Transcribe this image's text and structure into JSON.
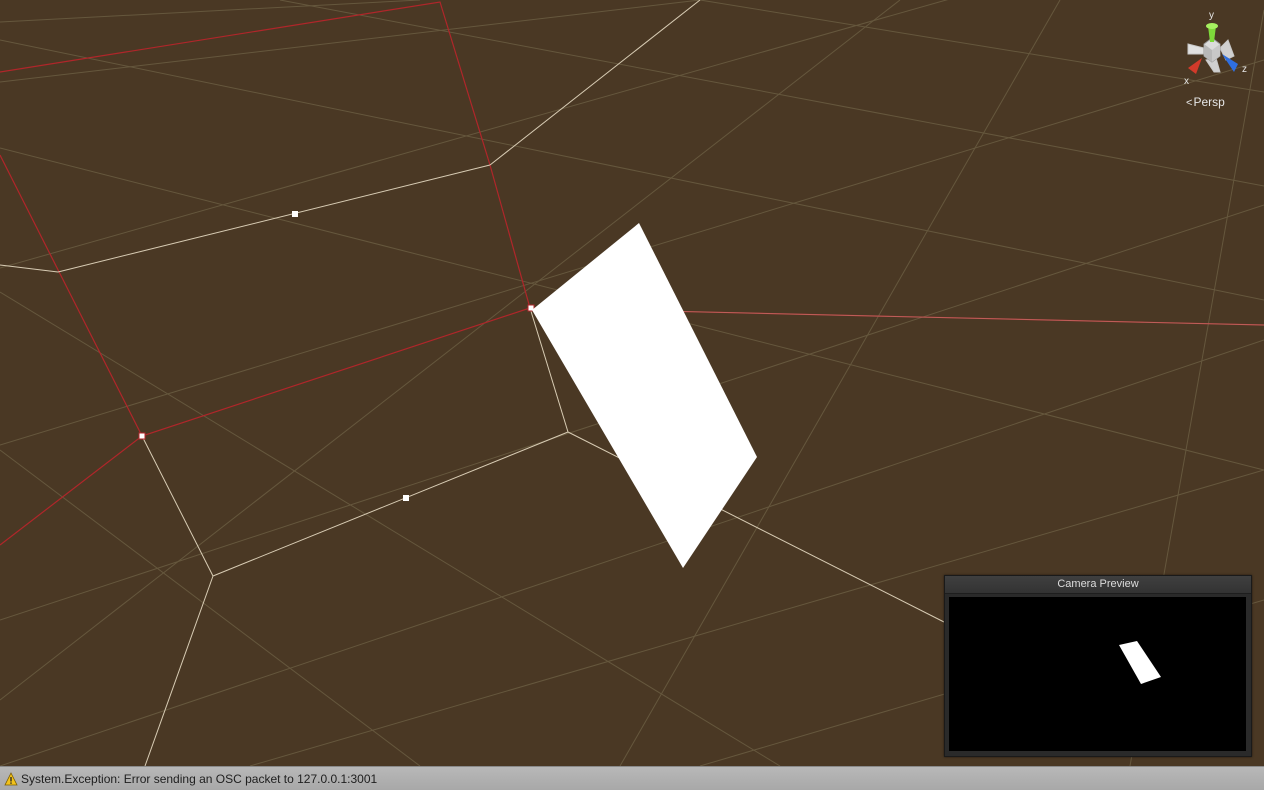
{
  "scene": {
    "background_color": "#4a3824",
    "grid_color": "#6f6246",
    "selection_color": "#b0262a",
    "wire_color": "#d8ccb4"
  },
  "gizmo": {
    "axis_y": "y",
    "axis_x": "x",
    "axis_z": "z",
    "projection_label": "Persp",
    "projection_icon": "perspective-chevron-icon"
  },
  "camera_preview": {
    "title": "Camera Preview"
  },
  "status_bar": {
    "icon": "warning-icon",
    "message": "System.Exception: Error sending an OSC packet to 127.0.0.1:3001"
  }
}
